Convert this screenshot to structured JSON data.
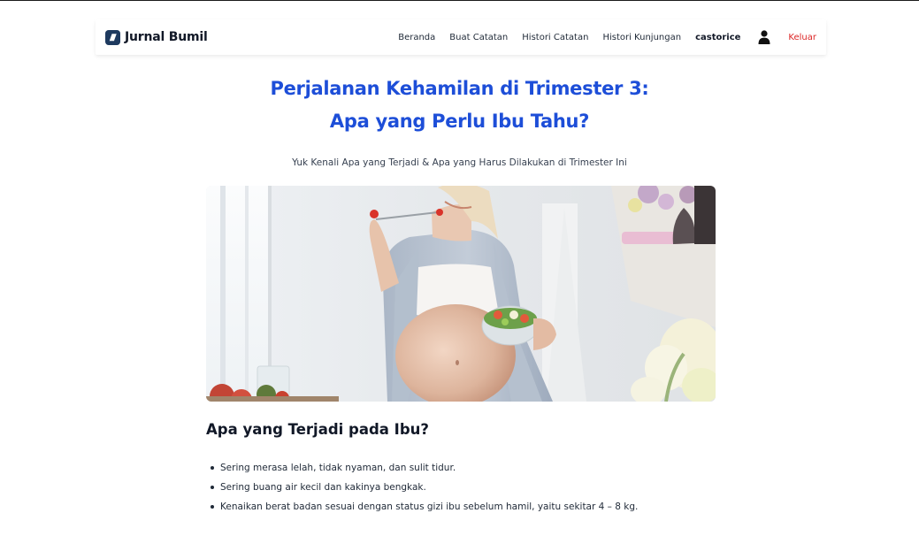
{
  "brand": {
    "name": "Jurnal Bumil",
    "icon": "journal-logo-icon",
    "color": "#1e3a5f"
  },
  "nav": {
    "items": [
      {
        "label": "Beranda"
      },
      {
        "label": "Buat Catatan"
      },
      {
        "label": "Histori Catatan"
      },
      {
        "label": "Histori Kunjungan"
      }
    ],
    "username": "castorice",
    "user_icon": "user-icon",
    "logout_label": "Keluar",
    "logout_color": "#dc2626"
  },
  "article": {
    "title_line1": "Perjalanan Kehamilan di Trimester 3:",
    "title_line2": "Apa yang Perlu Ibu Tahu?",
    "title_color": "#1d4ed8",
    "subtitle": "Yuk Kenali Apa yang Terjadi & Apa yang Harus Dilakukan di Trimester Ini",
    "hero_image": "pregnant-woman-eating-salad-photo",
    "section_heading": "Apa yang Terjadi pada Ibu?",
    "bullets": [
      "Sering merasa lelah, tidak nyaman, dan sulit tidur.",
      "Sering buang air kecil dan kakinya bengkak.",
      "Kenaikan berat badan sesuai dengan status gizi ibu sebelum hamil, yaitu sekitar 4 – 8 kg."
    ]
  }
}
